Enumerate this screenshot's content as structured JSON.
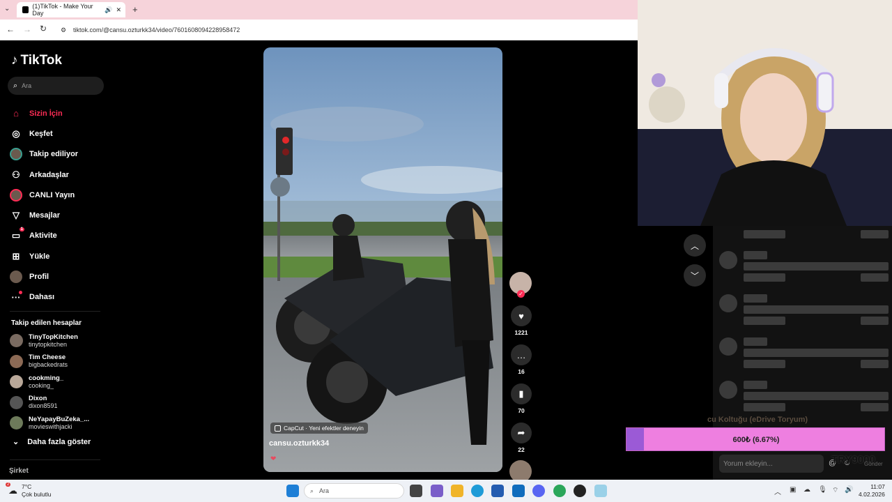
{
  "browser": {
    "tab_title": "(1)TikTok - Make Your Day",
    "url": "tiktok.com/@cansu.ozturkk34/video/7601608094228958472"
  },
  "tiktok": {
    "logo_text": "TikTok",
    "search_placeholder": "Ara",
    "nav": [
      {
        "label": "Sizin İçin",
        "icon": "home-icon"
      },
      {
        "label": "Keşfet",
        "icon": "compass-icon"
      },
      {
        "label": "Takip ediliyor",
        "icon": "following-avatar-icon"
      },
      {
        "label": "Arkadaşlar",
        "icon": "friends-icon"
      },
      {
        "label": "CANLI Yayın",
        "icon": "live-avatar-icon"
      },
      {
        "label": "Mesajlar",
        "icon": "send-icon"
      },
      {
        "label": "Aktivite",
        "icon": "activity-icon",
        "badge": "1"
      },
      {
        "label": "Yükle",
        "icon": "upload-icon"
      },
      {
        "label": "Profil",
        "icon": "profile-avatar-icon"
      },
      {
        "label": "Dahası",
        "icon": "more-icon"
      }
    ],
    "followed_title": "Takip edilen hesaplar",
    "followed": [
      {
        "name": "TinyTopKitchen",
        "user": "tinytopkitchen"
      },
      {
        "name": "Tim Cheese",
        "user": "bigbackedrats"
      },
      {
        "name": "cookming_",
        "user": "cooking_"
      },
      {
        "name": "Dixon",
        "user": "dixon8591"
      },
      {
        "name": "NeYapayBuZeka_...",
        "user": "movieswithjacki"
      }
    ],
    "show_more": "Daha fazla göster",
    "company": "Şirket",
    "video": {
      "capcut_chip": "CapCut · Yeni efektler deneyin",
      "author": "cansu.ozturkk34",
      "likes": "1221",
      "comments": "16",
      "saves": "70",
      "shares": "22"
    }
  },
  "stream": {
    "faded_text": "cu Koltuğu (eDrive Toryum)",
    "donation_text": "600₺ (6.67%)",
    "donation_progress": 0.0667,
    "comment_placeholder": "Yorum ekleyin...",
    "overlay_text": "TRY9000",
    "overlay_small": "Gönder"
  },
  "taskbar": {
    "temp": "7°C",
    "weather": "Çok bulutlu",
    "weather_badge": "2",
    "search": "Ara",
    "time": "11:07",
    "date": "4.02.2026"
  },
  "colors": {
    "accent": "#fe2c55",
    "donation_bar": "#ee7fe0",
    "donation_fill": "#9b5ad6"
  }
}
